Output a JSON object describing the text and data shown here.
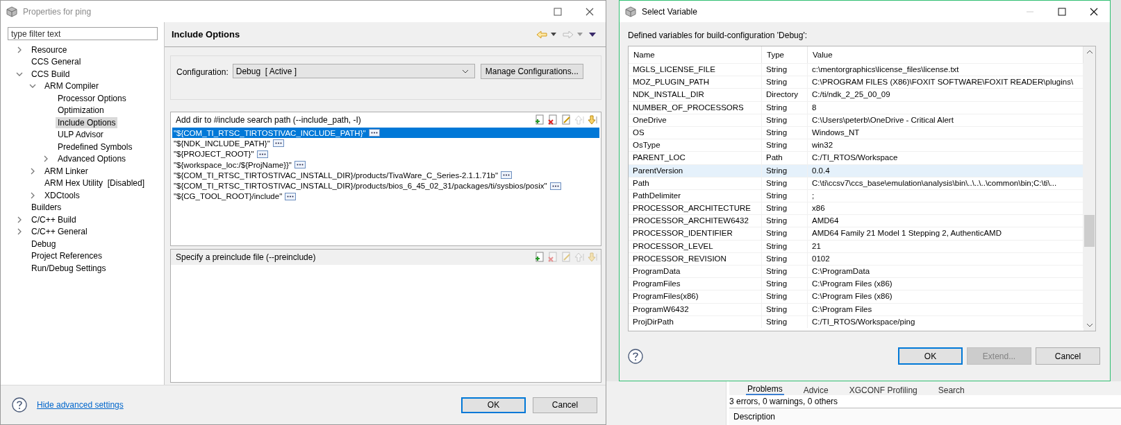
{
  "properties_dialog": {
    "title": "Properties for ping",
    "filter": {
      "placeholder": "type filter text"
    },
    "tree": [
      {
        "label": "Resource",
        "expanded": false,
        "selected": false
      },
      {
        "label": "CCS General",
        "selected": false
      },
      {
        "label": "CCS Build",
        "expanded": true,
        "selected": false,
        "children": [
          {
            "label": "ARM Compiler",
            "expanded": true,
            "selected": false,
            "children": [
              {
                "label": "Processor Options",
                "selected": false
              },
              {
                "label": "Optimization",
                "selected": false
              },
              {
                "label": "Include Options",
                "selected": true
              },
              {
                "label": "ULP Advisor",
                "selected": false
              },
              {
                "label": "Predefined Symbols",
                "selected": false
              },
              {
                "label": "Advanced Options",
                "expanded": false,
                "selected": false
              }
            ]
          },
          {
            "label": "ARM Linker",
            "expanded": false,
            "selected": false
          },
          {
            "label": "ARM Hex Utility  [Disabled]",
            "selected": false
          },
          {
            "label": "XDCtools",
            "expanded": false,
            "selected": false
          }
        ]
      },
      {
        "label": "Builders",
        "selected": false
      },
      {
        "label": "C/C++ Build",
        "expanded": false,
        "selected": false
      },
      {
        "label": "C/C++ General",
        "expanded": false,
        "selected": false
      },
      {
        "label": "Debug",
        "selected": false
      },
      {
        "label": "Project References",
        "selected": false
      },
      {
        "label": "Run/Debug Settings",
        "selected": false
      }
    ],
    "page_title": "Include Options",
    "configuration": {
      "label": "Configuration:",
      "value": "Debug  [ Active ]",
      "button": "Manage Configurations..."
    },
    "include_paths": {
      "title": "Add dir to #include search path (--include_path, -I)",
      "tools": [
        {
          "kind": "add",
          "disabled": false
        },
        {
          "kind": "delete",
          "disabled": false
        },
        {
          "kind": "edit",
          "disabled": false
        },
        {
          "kind": "up",
          "disabled": true
        },
        {
          "kind": "down",
          "disabled": false
        }
      ],
      "rows": [
        {
          "text": "\"${COM_TI_RTSC_TIRTOSTIVAC_INCLUDE_PATH}\"",
          "selected": true
        },
        {
          "text": "\"${NDK_INCLUDE_PATH}\"",
          "selected": false
        },
        {
          "text": "\"${PROJECT_ROOT}\"",
          "selected": false
        },
        {
          "text": "\"${workspace_loc:/${ProjName}}\"",
          "selected": false
        },
        {
          "text": "\"${COM_TI_RTSC_TIRTOSTIVAC_INSTALL_DIR}/products/TivaWare_C_Series-2.1.1.71b\"",
          "selected": false
        },
        {
          "text": "\"${COM_TI_RTSC_TIRTOSTIVAC_INSTALL_DIR}/products/bios_6_45_02_31/packages/ti/sysbios/posix\"",
          "selected": false
        },
        {
          "text": "\"${CG_TOOL_ROOT}/include\"",
          "selected": false
        }
      ]
    },
    "preinclude": {
      "title": "Specify a preinclude file (--preinclude)",
      "tools": [
        {
          "kind": "add",
          "disabled": false
        },
        {
          "kind": "delete",
          "disabled": true
        },
        {
          "kind": "edit",
          "disabled": true
        },
        {
          "kind": "up",
          "disabled": true
        },
        {
          "kind": "down",
          "disabled": true
        }
      ]
    },
    "help_link": "Hide advanced settings",
    "buttons": [
      {
        "label": "OK",
        "default": true
      },
      {
        "label": "Cancel",
        "default": false
      }
    ]
  },
  "select_variable": {
    "title": "Select Variable",
    "caption": "Defined variables for build-configuration 'Debug':",
    "columns": [
      "Name",
      "Type",
      "Value"
    ],
    "rows": [
      {
        "name": "MGLS_LICENSE_FILE",
        "type": "String",
        "value": "c:\\mentorgraphics\\license_files\\license.txt",
        "selected": false
      },
      {
        "name": "MOZ_PLUGIN_PATH",
        "type": "String",
        "value": "C:\\PROGRAM FILES (X86)\\FOXIT SOFTWARE\\FOXIT READER\\plugins\\",
        "selected": false
      },
      {
        "name": "NDK_INSTALL_DIR",
        "type": "Directory",
        "value": "C:/ti/ndk_2_25_00_09",
        "selected": false
      },
      {
        "name": "NUMBER_OF_PROCESSORS",
        "type": "String",
        "value": "8",
        "selected": false
      },
      {
        "name": "OneDrive",
        "type": "String",
        "value": "C:\\Users\\peterb\\OneDrive - Critical Alert",
        "selected": false
      },
      {
        "name": "OS",
        "type": "String",
        "value": "Windows_NT",
        "selected": false
      },
      {
        "name": "OsType",
        "type": "String",
        "value": "win32",
        "selected": false
      },
      {
        "name": "PARENT_LOC",
        "type": "Path",
        "value": "C:/TI_RTOS/Workspace",
        "selected": false
      },
      {
        "name": "ParentVersion",
        "type": "String",
        "value": "0.0.4",
        "selected": true
      },
      {
        "name": "Path",
        "type": "String",
        "value": "C:\\ti\\ccsv7\\ccs_base\\emulation\\analysis\\bin\\..\\..\\..\\common\\bin;C:\\ti\\...",
        "selected": false
      },
      {
        "name": "PathDelimiter",
        "type": "String",
        "value": ";",
        "selected": false
      },
      {
        "name": "PROCESSOR_ARCHITECTURE",
        "type": "String",
        "value": "x86",
        "selected": false
      },
      {
        "name": "PROCESSOR_ARCHITEW6432",
        "type": "String",
        "value": "AMD64",
        "selected": false
      },
      {
        "name": "PROCESSOR_IDENTIFIER",
        "type": "String",
        "value": "AMD64 Family 21 Model 1 Stepping 2, AuthenticAMD",
        "selected": false
      },
      {
        "name": "PROCESSOR_LEVEL",
        "type": "String",
        "value": "21",
        "selected": false
      },
      {
        "name": "PROCESSOR_REVISION",
        "type": "String",
        "value": "0102",
        "selected": false
      },
      {
        "name": "ProgramData",
        "type": "String",
        "value": "C:\\ProgramData",
        "selected": false
      },
      {
        "name": "ProgramFiles",
        "type": "String",
        "value": "C:\\Program Files (x86)",
        "selected": false
      },
      {
        "name": "ProgramFiles(x86)",
        "type": "String",
        "value": "C:\\Program Files (x86)",
        "selected": false
      },
      {
        "name": "ProgramW6432",
        "type": "String",
        "value": "C:\\Program Files",
        "selected": false
      },
      {
        "name": "ProjDirPath",
        "type": "String",
        "value": "C:/TI_RTOS/Workspace/ping",
        "selected": false
      }
    ],
    "buttons": [
      {
        "label": "OK",
        "default": true,
        "disabled": false
      },
      {
        "label": "Extend...",
        "default": false,
        "disabled": true
      },
      {
        "label": "Cancel",
        "default": false,
        "disabled": false
      }
    ]
  },
  "background_ide": {
    "tabs": [
      {
        "label": "Problems",
        "selected": true
      },
      {
        "label": "Advice",
        "selected": false
      },
      {
        "label": "XGCONF Profiling",
        "selected": false
      },
      {
        "label": "Search",
        "selected": false
      }
    ],
    "summary": "3 errors, 0 warnings, 0 others",
    "column": "Description"
  }
}
